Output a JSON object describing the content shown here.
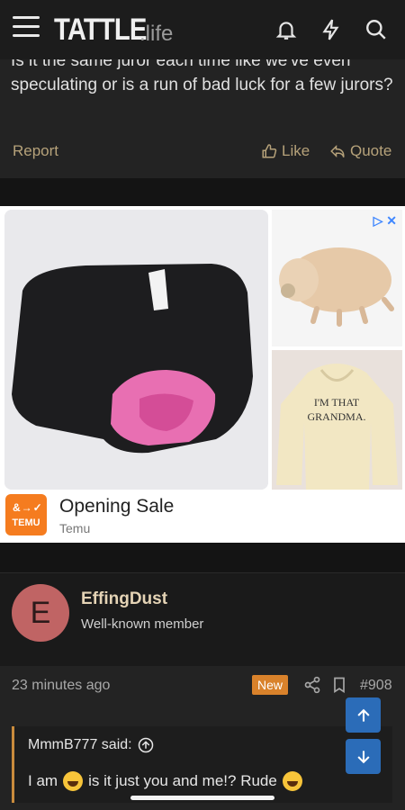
{
  "header": {
    "logo": "TATTLE",
    "logo_suffix": ".life",
    "icons": [
      "menu-icon",
      "bell-icon",
      "bolt-icon",
      "search-icon"
    ]
  },
  "post": {
    "text": "Is it the same juror each time like we've even speculating or is a run of bad luck for a few jurors?",
    "report_label": "Report",
    "like_label": "Like",
    "quote_label": "Quote"
  },
  "ad": {
    "title": "Opening Sale",
    "advertiser": "Temu",
    "logo_text": "TEMU",
    "logo_glyph": "&→✓",
    "hoodie_text": "I'M THAT GRANDMA."
  },
  "member": {
    "avatar_letter": "E",
    "username": "EffingDust",
    "role": "Well-known member",
    "avatar_color": "#c06464"
  },
  "meta": {
    "time": "23 minutes ago",
    "badge": "New",
    "post_number": "#908"
  },
  "quote": {
    "author_line": "MmmB777 said:",
    "body_start": "I am",
    "body_mid": "is it just you and me!? Rude"
  },
  "colors": {
    "accent": "#b6a27a",
    "badge": "#d9822b",
    "scroll_button": "#2b6cb8"
  }
}
